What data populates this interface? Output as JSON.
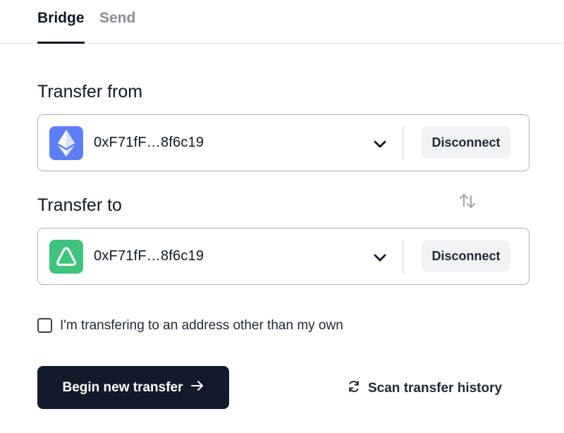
{
  "tabs": [
    {
      "label": "Bridge",
      "active": true
    },
    {
      "label": "Send",
      "active": false
    }
  ],
  "transfer_from": {
    "label": "Transfer from",
    "chain_icon": "ethereum-icon",
    "address": "0xF71fF…8f6c19",
    "disconnect_label": "Disconnect"
  },
  "transfer_to": {
    "label": "Transfer to",
    "chain_icon": "green-triangle-chain-icon",
    "address": "0xF71fF…8f6c19",
    "disconnect_label": "Disconnect"
  },
  "other_address_checkbox": {
    "label": "I'm transfering to an address other than my own",
    "checked": false
  },
  "actions": {
    "begin_label": "Begin new transfer",
    "scan_label": "Scan transfer history"
  },
  "colors": {
    "primary_button": "#131a2b",
    "eth_icon_bg": "#5d7ef7",
    "green_icon_bg": "#3ec47c"
  }
}
